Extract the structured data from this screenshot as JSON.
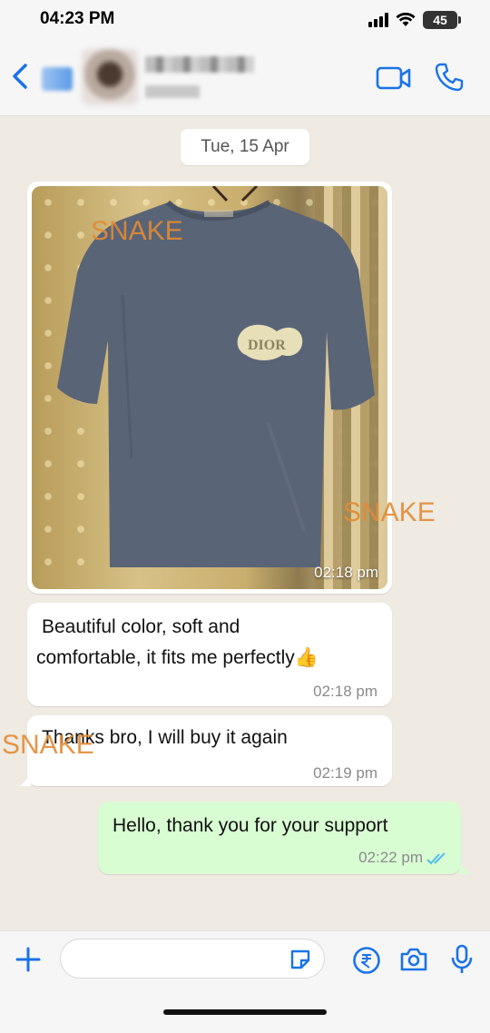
{
  "status_bar": {
    "time": "04:23 PM",
    "battery": "45",
    "icons": [
      "signal-icon",
      "wifi-icon",
      "battery-icon"
    ]
  },
  "header": {
    "icons": [
      "back-chevron-icon",
      "video-call-icon",
      "phone-icon"
    ]
  },
  "chat": {
    "date": "Tue, 15 Apr",
    "messages": [
      {
        "type": "image",
        "time": "02:18 pm",
        "direction": "incoming"
      },
      {
        "type": "text",
        "text_line1": "Beautiful color, soft and",
        "text_line2": "comfortable, it fits me perfectly👍",
        "time": "02:18 pm",
        "direction": "incoming"
      },
      {
        "type": "text",
        "text": "Thanks bro, I will buy it again",
        "time": "02:19 pm",
        "direction": "incoming"
      },
      {
        "type": "text",
        "text": "Hello, thank you for your support",
        "time": "02:22 pm",
        "direction": "outgoing",
        "status": "read"
      }
    ],
    "watermark": "SNAKE"
  },
  "input_bar": {
    "placeholder": "",
    "icons": [
      "plus-icon",
      "sticker-icon",
      "rupee-payment-icon",
      "camera-icon",
      "microphone-icon"
    ]
  },
  "colors": {
    "accent": "#1a73e8",
    "chat_background": "#efeae2",
    "outgoing_bubble": "#d9fdd3",
    "incoming_bubble": "#ffffff",
    "watermark": "#e38b35",
    "read_ticks": "#53bdeb"
  }
}
